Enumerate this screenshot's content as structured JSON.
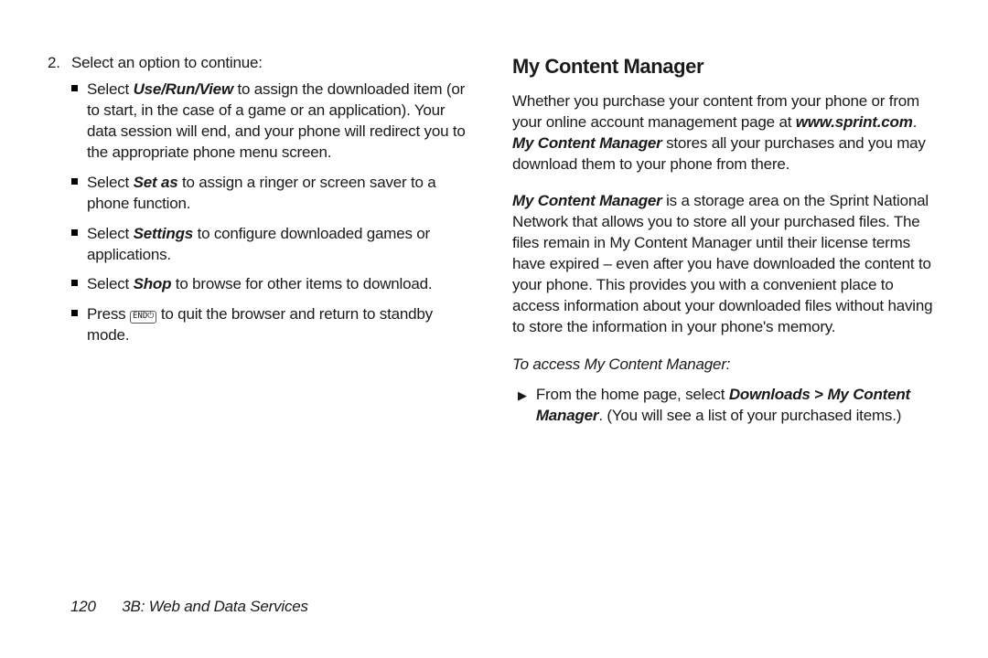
{
  "left": {
    "step_num": "2.",
    "step_text": "Select an option to continue:",
    "b1_a": "Select ",
    "b1_b": "Use/Run/View",
    "b1_c": " to assign the downloaded item (or to start, in the case of a game or an application). Your data session will end, and your phone will redirect you to the appropriate phone menu screen.",
    "b2_a": "Select ",
    "b2_b": "Set as",
    "b2_c": " to assign a ringer or screen saver to a phone function.",
    "b3_a": "Select ",
    "b3_b": "Settings",
    "b3_c": " to configure downloaded games or applications.",
    "b4_a": "Select ",
    "b4_b": "Shop",
    "b4_c": " to browse for other items to download.",
    "b5_a": "Press ",
    "b5_key": "END⏻",
    "b5_c": " to quit the browser and return to standby mode."
  },
  "right": {
    "heading": "My Content Manager",
    "p1_a": "Whether you purchase your content from your phone or from your online account management page at ",
    "p1_b": "www.sprint.com",
    "p1_c": ". ",
    "p1_d": "My Content Manager",
    "p1_e": " stores all your purchases and you may download them to your phone from there.",
    "p2_a": "My Content Manager",
    "p2_b": " is a storage area on the Sprint National Network that allows you to store all your purchased files. The files remain in My Content Manager until their license terms have expired – even after you have downloaded the content to your phone. This provides you with a convenient place to access information about your downloaded files without having to store the information in your phone's memory.",
    "subhead": "To access My Content Manager:",
    "s1_a": "From the home page, select ",
    "s1_b": "Downloads",
    "s1_c": " > ",
    "s1_d": "My Content Manager",
    "s1_e": ". (You will see a list of your purchased items.)"
  },
  "footer": {
    "page": "120",
    "section": "3B: Web and Data Services"
  }
}
